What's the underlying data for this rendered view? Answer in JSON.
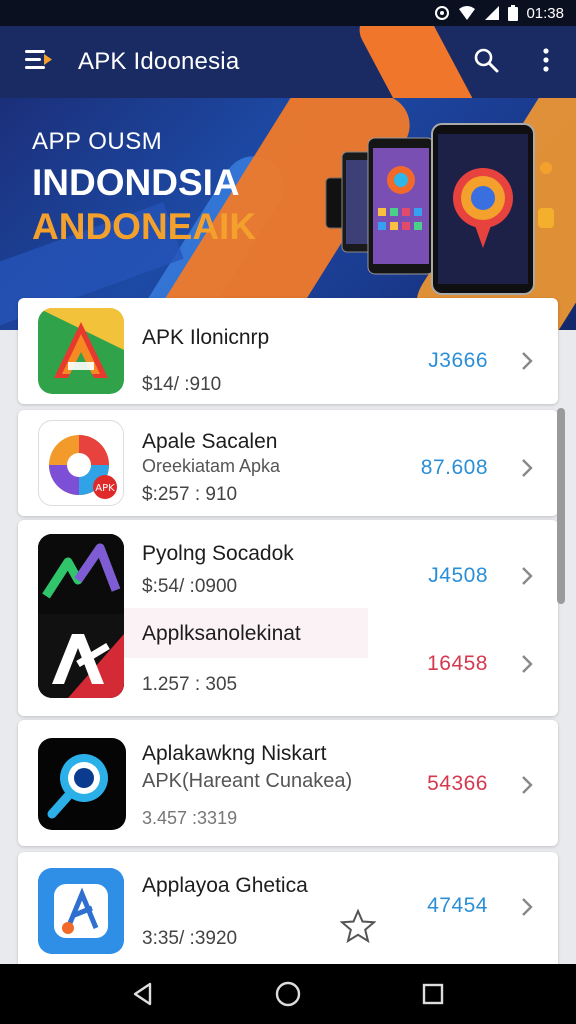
{
  "status_bar": {
    "time": "01:38",
    "icons": [
      "vpn-icon",
      "wifi-icon",
      "signal-icon",
      "battery-icon"
    ]
  },
  "app_bar": {
    "title": "APK Idoonesia",
    "icons": [
      "menu-icon",
      "search-icon",
      "more-vert-icon"
    ]
  },
  "banner": {
    "line1": "APP OUSM",
    "line2": "INDONDSIA",
    "line3": "ANDONEAIK"
  },
  "apps": [
    {
      "name": "APK Ilonicnrp",
      "price": "$14/ :910",
      "count": "J3666",
      "count_color": "#2b8fd6"
    },
    {
      "name": "Apale Sacalen",
      "subtitle": "Oreekiatam Apka",
      "price": "$:257 : 910",
      "count": "87.608",
      "count_color": "#2b8fd6"
    },
    {
      "name": "Pyolng Socadok",
      "price": "$:54/ :0900",
      "count": "J4508",
      "count_color": "#2b8fd6"
    },
    {
      "name": "Applksanolekinat",
      "price": "1.257 : 305",
      "count": "16458",
      "count_color": "#d6394f"
    },
    {
      "name": "Aplakawkng Niskart",
      "subtitle": "APK(Hareant Cunakea)",
      "price": "3.457 :3319",
      "count": "54366",
      "count_color": "#d6394f"
    },
    {
      "name": "Applayoa Ghetica",
      "price": "3:35/ :3920",
      "count": "47454",
      "count_color": "#2b8fd6"
    }
  ],
  "nav_bar": {
    "icons": [
      "back-icon",
      "home-icon",
      "recents-icon"
    ]
  },
  "colors": {
    "app_bar": "#1a2b63",
    "accent_orange": "#f07a2a",
    "link_blue": "#2b8fd6",
    "red": "#d6394f"
  }
}
